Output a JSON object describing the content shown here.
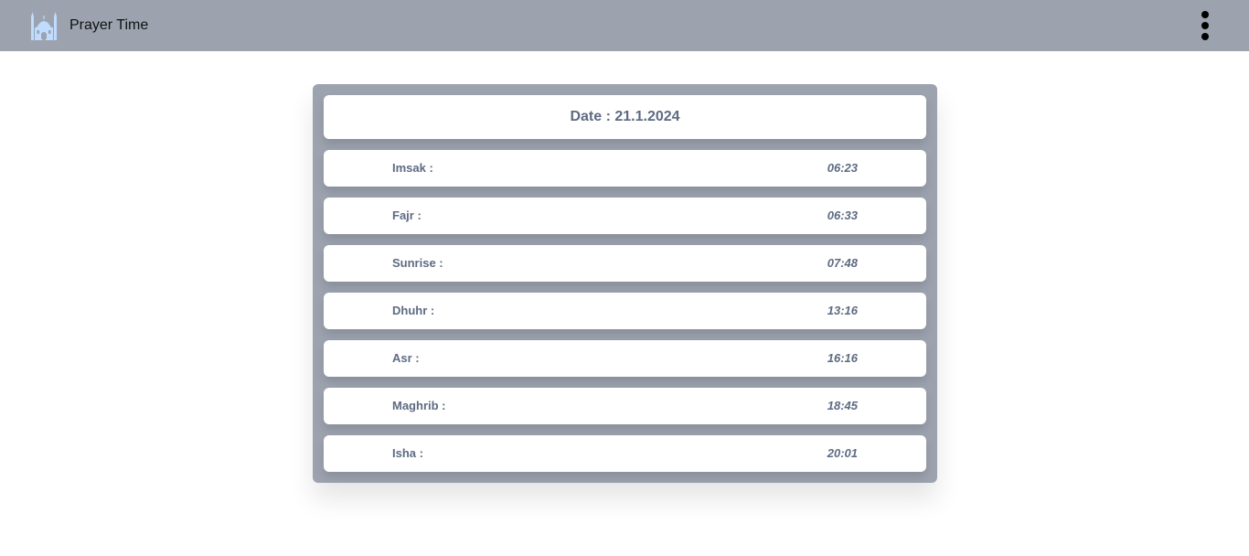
{
  "app": {
    "title": "Prayer Time",
    "logo_icon": "mosque-icon",
    "menu_icon": "more-vertical-icon"
  },
  "colors": {
    "topbar": "#9ca3af",
    "card": "#9ca3af",
    "text": "#5d6b82",
    "logo": "#bfdbfe"
  },
  "schedule": {
    "date_label": "Date : 21.1.2024",
    "prayers": [
      {
        "name": "Imsak :",
        "time": "06:23"
      },
      {
        "name": "Fajr :",
        "time": "06:33"
      },
      {
        "name": "Sunrise :",
        "time": "07:48"
      },
      {
        "name": "Dhuhr :",
        "time": "13:16"
      },
      {
        "name": "Asr :",
        "time": "16:16"
      },
      {
        "name": "Maghrib :",
        "time": "18:45"
      },
      {
        "name": "Isha :",
        "time": "20:01"
      }
    ]
  }
}
